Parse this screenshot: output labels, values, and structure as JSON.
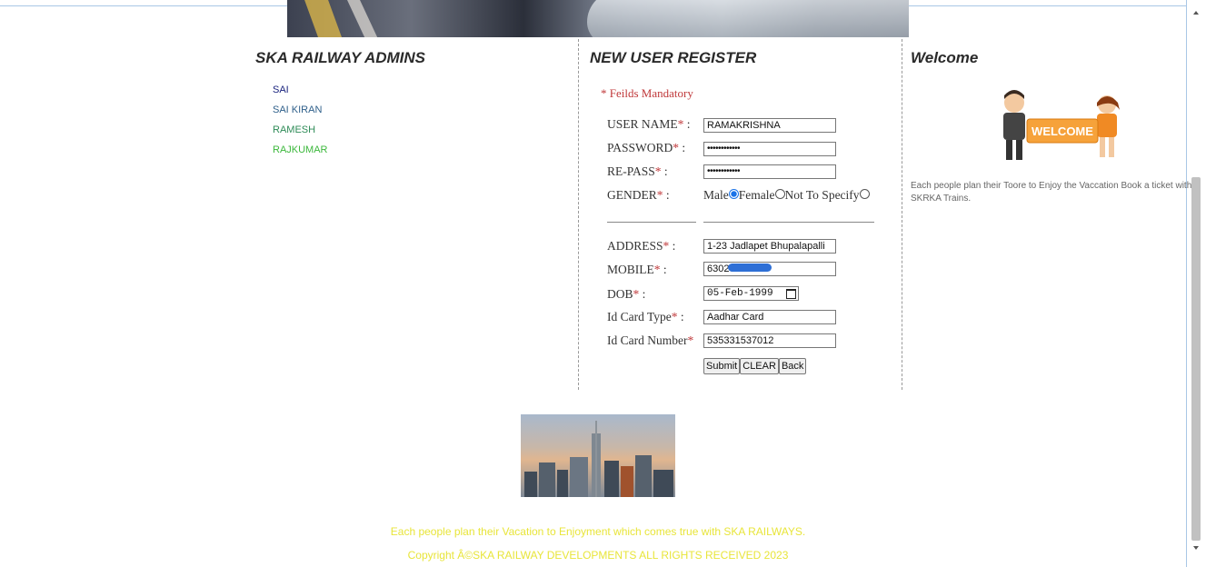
{
  "admins": {
    "heading": "SKA RAILWAY ADMINS",
    "items": [
      {
        "label": "SAI",
        "color": "#1a237e"
      },
      {
        "label": "SAI KIRAN",
        "color": "#2e5f8a"
      },
      {
        "label": "RAMESH",
        "color": "#2e8b57"
      },
      {
        "label": "RAJKUMAR",
        "color": "#3cb83c"
      }
    ]
  },
  "register": {
    "heading": "NEW USER REGISTER",
    "note": "* Feilds Mandatory",
    "labels": {
      "username": "USER NAME",
      "password": "PASSWORD",
      "repass": "RE-PASS",
      "gender": "GENDER",
      "address": "ADDRESS",
      "mobile": "MOBILE",
      "dob": "DOB",
      "idtype": "Id Card Type",
      "idnum": "Id Card Number"
    },
    "star": "*",
    "colon": " :",
    "values": {
      "username": "RAMAKRISHNA",
      "password": "••••••••••••",
      "repass": "••••••••••••",
      "address": "1-23 Jadlapet Bhupalapalli",
      "mobile": "63026",
      "dob": "05-Feb-1999",
      "idtype": "Aadhar Card",
      "idnum": "535331537012"
    },
    "gender_options": {
      "male": "Male",
      "female": "Female",
      "other": "Not To Specify",
      "selected": "male"
    },
    "buttons": {
      "submit": "Submit",
      "clear": "CLEAR",
      "back": "Back"
    }
  },
  "welcome": {
    "heading": "Welcome",
    "image_text": "WELCOME",
    "text": "Each people plan their Toore to Enjoy the Vaccation Book a ticket with SKRKA Trains."
  },
  "footer": {
    "line1": "Each people plan their Vacation to Enjoyment which comes true with SKA RAILWAYS.",
    "line2": "Copyright Â©SKA RAILWAY DEVELOPMENTS ALL RIGHTS RECEIVED 2023"
  }
}
